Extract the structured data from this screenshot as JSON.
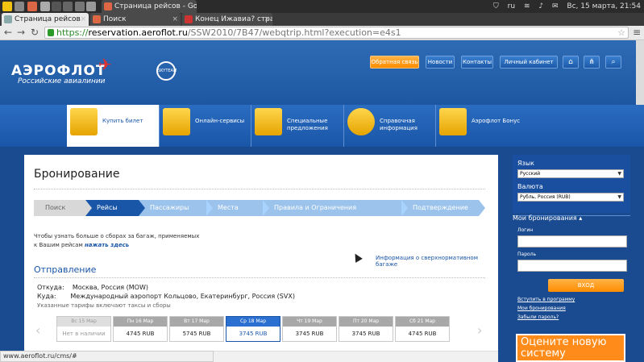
{
  "os": {
    "tabs": [
      {
        "title": "Страница рейсов"
      },
      {
        "title": "Поиск"
      },
      {
        "title": "Конец Ижавиа? стран"
      }
    ],
    "active_window_title": "Страница рейсов - Google ...",
    "tray": {
      "lang": "ru",
      "clock": "Вс, 15 марта, 21:54"
    }
  },
  "browser": {
    "url_scheme": "https://",
    "url_host": "reservation.aeroflot.ru",
    "url_path": "/SSW2010/7B47/webqtrip.html?execution=e4s1",
    "status_url": "www.aeroflot.ru/cms/#"
  },
  "header": {
    "logo_text": "АЭРОФЛОТ",
    "logo_sub": "Российские авиалинии",
    "skyteam": "SKYTEAM",
    "buttons": {
      "feedback": "Обратная связь",
      "news": "Новости",
      "contacts": "Контакты",
      "cabinet": "Личный кабинет"
    }
  },
  "nav": {
    "items": [
      {
        "label": "Купить билет"
      },
      {
        "label": "Онлайн-сервисы"
      },
      {
        "label": "Специальные предложения"
      },
      {
        "label": "Справочная информация"
      },
      {
        "label": "Аэрофлот Бонус"
      }
    ]
  },
  "main": {
    "title": "Бронирование",
    "steps": [
      "Поиск",
      "Рейсы",
      "Пассажиры",
      "Места",
      "Правила и Ограничения",
      "Подтверждение"
    ],
    "baggage_note_line1": "Чтобы узнать больше о сборах за багаж, применяемых",
    "baggage_note_line2": "к Вашим рейсам",
    "baggage_note_link": "нажать здесь",
    "oversize_link": "Информация о сверхнормативном багаже",
    "section_title": "Отправление",
    "from_label": "Откуда:",
    "from_value": "Москва, Россия (MOW)",
    "to_label": "Куда:",
    "to_value": "Международный аэропорт Кольцово, Екатеринбург, Россия (SVX)",
    "fare_note": "Указанные тарифы включают таксы и сборы",
    "dates": [
      {
        "day": "Вс 15 Мар",
        "price": "Нет в наличии"
      },
      {
        "day": "Пн 16 Мар",
        "price": "4745 RUB"
      },
      {
        "day": "Вт 17 Мар",
        "price": "5745 RUB"
      },
      {
        "day": "Ср 18 Мар",
        "price": "3745 RUB"
      },
      {
        "day": "Чт 19 Мар",
        "price": "3745 RUB"
      },
      {
        "day": "Пт 20 Мар",
        "price": "3745 RUB"
      },
      {
        "day": "Сб 21 Мар",
        "price": "4745 RUB"
      }
    ]
  },
  "sidebar": {
    "lang_label": "Язык",
    "lang_value": "Русский",
    "currency_label": "Валюта",
    "currency_value": "Рубль, Россия (RUB)",
    "bookings_title": "Мои бронирования ▴",
    "login_label": "Логин",
    "password_label": "Пароль",
    "login_button": "ВХОД",
    "link_join": "Вступить в программу",
    "link_bookings": "Мои бронирования",
    "link_forgot": "Забыли пароль?",
    "promo_text": "Оцените новую систему"
  },
  "colors": {
    "brand_blue": "#1a56a8",
    "accent_orange": "#ff8c00"
  }
}
